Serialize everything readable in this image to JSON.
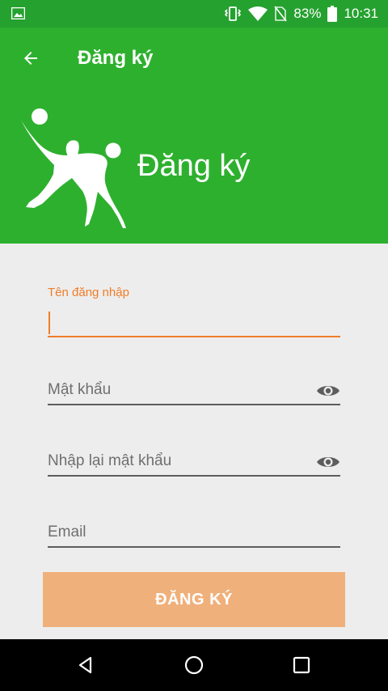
{
  "status_bar": {
    "battery_percent": "83%",
    "time": "10:31",
    "icons": [
      "image-icon",
      "vibrate-icon",
      "wifi-icon",
      "no-sim-icon",
      "battery-icon"
    ]
  },
  "app_bar": {
    "title": "Đăng ký",
    "back_icon": "arrow-left-icon"
  },
  "hero": {
    "title": "Đăng ký",
    "image": "football-player-icon"
  },
  "form": {
    "username": {
      "label": "Tên đăng nhập",
      "value": ""
    },
    "password": {
      "placeholder": "Mật khẩu",
      "icon": "eye-icon"
    },
    "confirm_password": {
      "placeholder": "Nhập lại mật khẩu",
      "icon": "eye-icon"
    },
    "email": {
      "placeholder": "Email"
    },
    "submit_label": "ĐĂNG KÝ"
  },
  "nav_bar": {
    "icons": [
      "back-triangle-icon",
      "home-circle-icon",
      "recents-square-icon"
    ]
  },
  "colors": {
    "primary": "#2eb02f",
    "status_bar": "#25a12f",
    "accent": "#f07d28",
    "button": "#f0b07b",
    "background": "#ededed"
  }
}
